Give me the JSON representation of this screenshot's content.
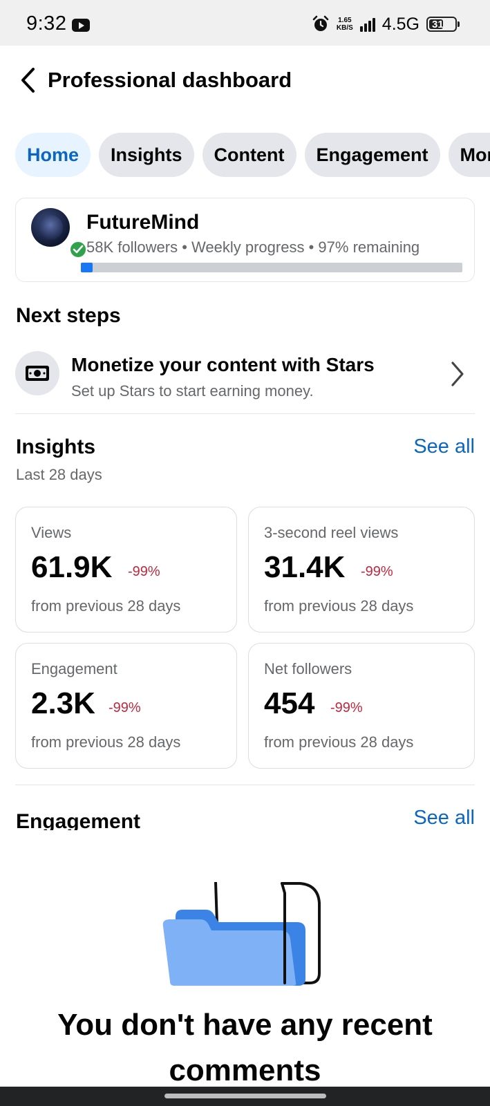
{
  "status_bar": {
    "time": "9:32",
    "speed_value": "1.65",
    "speed_unit": "KB/S",
    "network": "4.5G",
    "battery": "31",
    "icons": [
      "youtube-icon",
      "alarm-icon",
      "signal-icon",
      "battery-icon"
    ]
  },
  "header": {
    "title": "Professional dashboard",
    "back_icon": "chevron-left-icon"
  },
  "tabs": [
    {
      "label": "Home",
      "active": true
    },
    {
      "label": "Insights",
      "active": false
    },
    {
      "label": "Content",
      "active": false
    },
    {
      "label": "Engagement",
      "active": false
    },
    {
      "label": "Mon",
      "active": false
    }
  ],
  "profile": {
    "name": "FutureMind",
    "followers": "58K followers",
    "progress_label": "Weekly progress",
    "remaining": "97% remaining",
    "progress_fraction": 0.03,
    "verified_icon": "verified-check-icon"
  },
  "next_steps": {
    "title": "Next steps",
    "item": {
      "title": "Monetize your content with Stars",
      "subtitle": "Set up Stars to start earning money.",
      "icon": "money-icon"
    }
  },
  "insights": {
    "title": "Insights",
    "see_all": "See all",
    "subtitle": "Last 28 days",
    "metrics": [
      {
        "label": "Views",
        "value": "61.9K",
        "change": "-99%",
        "footnote": "from previous 28 days"
      },
      {
        "label": "3-second reel views",
        "value": "31.4K",
        "change": "-99%",
        "footnote": "from previous 28 days"
      },
      {
        "label": "Engagement",
        "value": "2.3K",
        "change": "-99%",
        "footnote": "from previous 28 days"
      },
      {
        "label": "Net followers",
        "value": "454",
        "change": "-99%",
        "footnote": "from previous 28 days"
      }
    ]
  },
  "engagement": {
    "title": "Engagement",
    "see_all": "See all",
    "empty_icon": "empty-folder-icon",
    "empty_line1": "You don't have any recent",
    "empty_line2": "comments"
  },
  "colors": {
    "accent": "#0a66c2",
    "progress": "#1877f2",
    "negative": "#c0283d",
    "verified": "#31a24c"
  }
}
